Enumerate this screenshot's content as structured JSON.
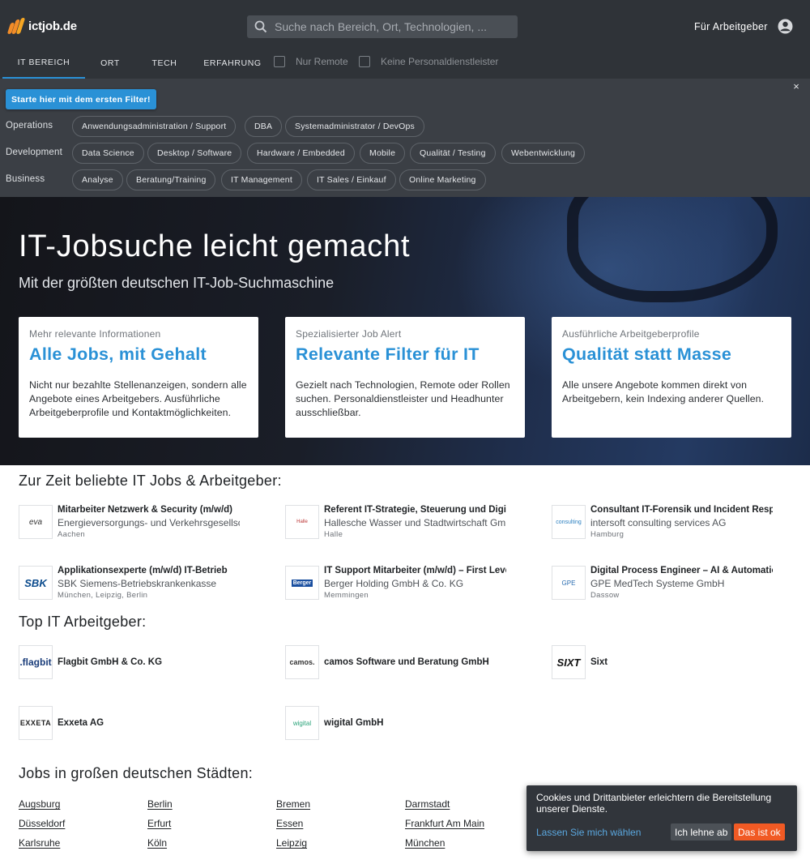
{
  "header": {
    "logo_text": "ictjob.de",
    "search_placeholder": "Suche nach Bereich, Ort, Technologien, ...",
    "employer_link": "Für Arbeitgeber",
    "tabs": [
      {
        "label": "IT Bereich",
        "active": true
      },
      {
        "label": "Ort",
        "active": false
      },
      {
        "label": "Tech",
        "active": false
      },
      {
        "label": "Erfahrung",
        "active": false
      }
    ],
    "checkboxes": [
      {
        "label": "Nur Remote",
        "checked": false
      },
      {
        "label": "Keine Personaldienstleister",
        "checked": false
      }
    ]
  },
  "filters": {
    "start_button": "Starte hier mit dem ersten Filter!",
    "close": "×",
    "groups": [
      {
        "label": "Operations",
        "chips": [
          "Anwendungsadministration / Support",
          "DBA",
          "Systemadministrator / DevOps"
        ]
      },
      {
        "label": "Development",
        "chips": [
          "Data Science",
          "Desktop / Software",
          "Hardware / Embedded",
          "Mobile",
          "Qualität / Testing",
          "Webentwicklung"
        ]
      },
      {
        "label": "Business",
        "chips": [
          "Analyse",
          "Beratung/Training",
          "IT Management",
          "IT Sales / Einkauf",
          "Online Marketing"
        ]
      }
    ]
  },
  "hero": {
    "title": "IT-Jobsuche leicht gemacht",
    "subtitle": "Mit der größten deutschen IT-Job-Suchmaschine",
    "cards": [
      {
        "kicker": "Mehr relevante Informationen",
        "title": "Alle Jobs, mit Gehalt",
        "text": "Nicht nur bezahlte Stellenanzeigen, sondern alle Angebote eines Arbeitgebers. Ausführliche Arbeitgeberprofile und Kontaktmöglichkeiten."
      },
      {
        "kicker": "Spezialisierter Job Alert",
        "title": "Relevante Filter für IT",
        "text": "Gezielt nach Technologien, Remote oder Rollen suchen. Personaldienstleister und Headhunter ausschließbar."
      },
      {
        "kicker": "Ausführliche Arbeitgeberprofile",
        "title": "Qualität statt Masse",
        "text": "Alle unsere Angebote kommen direkt von Arbeitgebern, kein Indexing anderer Quellen."
      }
    ]
  },
  "popular": {
    "title": "Zur Zeit beliebte IT Jobs & Arbeitgeber:",
    "jobs": [
      {
        "logo": "eva",
        "title": "Mitarbeiter Netzwerk & Security (m/w/d)",
        "company": "Energieversorgungs- und Verkehrsgesellschaft",
        "city": "Aachen"
      },
      {
        "logo": "Halle",
        "title": "Referent IT-Strategie, Steuerung und Digitalisierung",
        "company": "Hallesche Wasser und Stadtwirtschaft GmbH",
        "city": "Halle"
      },
      {
        "logo": "consulting",
        "title": "Consultant IT-Forensik und Incident Response",
        "company": "intersoft consulting services AG",
        "city": "Hamburg"
      },
      {
        "logo": "SBK",
        "title": "Applikationsexperte (m/w/d) IT-Betrieb",
        "company": "SBK Siemens-Betriebskrankenkasse",
        "city": "München, Leipzig, Berlin"
      },
      {
        "logo": "Berger",
        "title": "IT Support Mitarbeiter (m/w/d) – First Level",
        "company": "Berger Holding GmbH & Co. KG",
        "city": "Memmingen"
      },
      {
        "logo": "GPE",
        "title": "Digital Process Engineer – AI & Automation",
        "company": "GPE MedTech Systeme GmbH",
        "city": "Dassow"
      }
    ]
  },
  "top_employers": {
    "title": "Top IT Arbeitgeber:",
    "items": [
      {
        "logo": ".flagbit",
        "name": "Flagbit GmbH & Co. KG"
      },
      {
        "logo": "camos.",
        "name": "camos Software und Beratung GmbH"
      },
      {
        "logo": "SIXT",
        "name": "Sixt"
      },
      {
        "logo": "EXXETA",
        "name": "Exxeta AG"
      },
      {
        "logo": "wigital",
        "name": "wigital GmbH"
      }
    ]
  },
  "cities": {
    "title": "Jobs in großen deutschen Städten:",
    "items": [
      "Augsburg",
      "Berlin",
      "Bremen",
      "Darmstadt",
      "Düsseldorf",
      "Erfurt",
      "Essen",
      "Frankfurt Am Main",
      "Karlsruhe",
      "Köln",
      "Leipzig",
      "München"
    ]
  },
  "cookie": {
    "text": "Cookies und Drittanbieter erleichtern die Bereitstellung unserer Dienste.",
    "choose": "Lassen Sie mich wählen",
    "decline": "Ich lehne ab",
    "accept": "Das ist ok"
  },
  "colors": {
    "accent": "#2a91d6",
    "header_bg": "#2f3338",
    "accept": "#f15a24"
  }
}
